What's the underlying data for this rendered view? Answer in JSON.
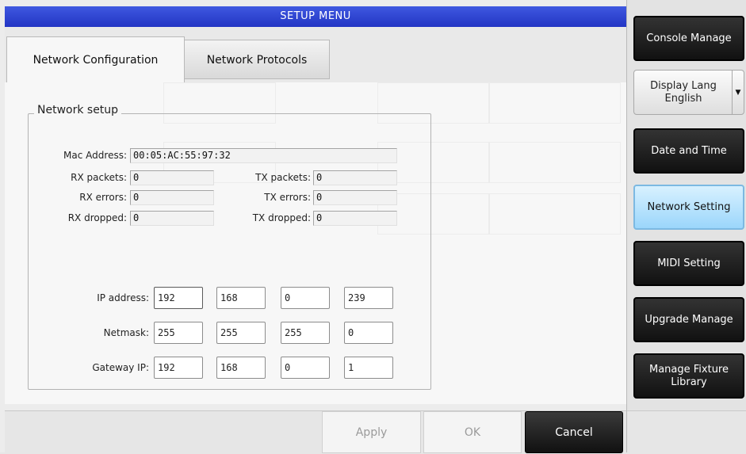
{
  "title": "SETUP MENU",
  "tabs": [
    {
      "label": "Network Configuration",
      "active": true
    },
    {
      "label": "Network Protocols",
      "active": false
    }
  ],
  "network_setup": {
    "legend": "Network setup",
    "mac_label": "Mac Address:",
    "mac_value": "00:05:AC:55:97:32",
    "rx_packets_label": "RX packets:",
    "rx_packets_value": "0",
    "tx_packets_label": "TX packets:",
    "tx_packets_value": "0",
    "rx_errors_label": "RX errors:",
    "rx_errors_value": "0",
    "tx_errors_label": "TX errors:",
    "tx_errors_value": "0",
    "rx_dropped_label": "RX dropped:",
    "rx_dropped_value": "0",
    "tx_dropped_label": "TX dropped:",
    "tx_dropped_value": "0",
    "ip_label": "IP address:",
    "ip": [
      "192",
      "168",
      "0",
      "239"
    ],
    "netmask_label": "Netmask:",
    "netmask": [
      "255",
      "255",
      "255",
      "0"
    ],
    "gateway_label": "Gateway IP:",
    "gateway": [
      "192",
      "168",
      "0",
      "1"
    ]
  },
  "buttons": {
    "apply": "Apply",
    "ok": "OK",
    "cancel": "Cancel"
  },
  "sidebar": {
    "console_manage": "Console Manage",
    "display_lang_line1": "Display Lang",
    "display_lang_line2": "English",
    "date_time": "Date and Time",
    "network_setting": "Network Setting",
    "midi_setting": "MIDI Setting",
    "upgrade_manage": "Upgrade Manage",
    "manage_fixture_line1": "Manage Fixture",
    "manage_fixture_line2": "Library"
  },
  "colors": {
    "title_bar": "#2f45d6",
    "active_sidebar": "#a9dcfb",
    "dark_button": "#1a1a1a"
  }
}
